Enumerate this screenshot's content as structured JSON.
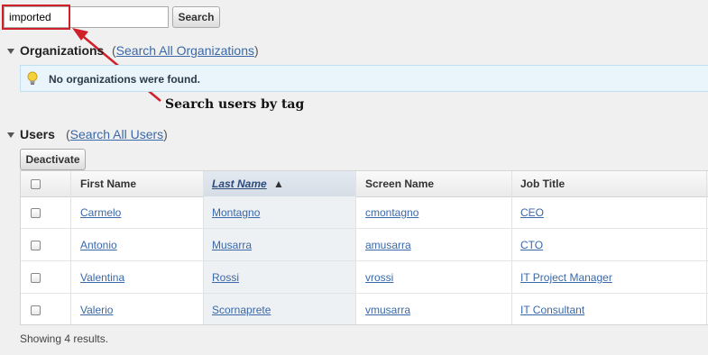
{
  "search": {
    "value": "imported",
    "button_label": "Search"
  },
  "annotation": {
    "text": "Search users by tag"
  },
  "organizations": {
    "title": "Organizations",
    "link_open": "(",
    "link_label": "Search All Organizations",
    "link_close": ")",
    "message": "No organizations were found."
  },
  "users": {
    "title": "Users",
    "link_open": "(",
    "link_label": "Search All Users",
    "link_close": ")",
    "deactivate_label": "Deactivate",
    "columns": [
      "First Name",
      "Last Name",
      "Screen Name",
      "Job Title"
    ],
    "sort_indicator": "▲",
    "rows": [
      {
        "first": "Carmelo",
        "last": "Montagno",
        "screen": "cmontagno",
        "job": "CEO"
      },
      {
        "first": "Antonio",
        "last": "Musarra",
        "screen": "amusarra",
        "job": "CTO"
      },
      {
        "first": "Valentina",
        "last": "Rossi",
        "screen": "vrossi",
        "job": "IT Project Manager"
      },
      {
        "first": "Valerio",
        "last": "Scornaprete",
        "screen": "vmusarra",
        "job": "IT Consultant"
      }
    ],
    "footer": "Showing 4 results."
  },
  "colors": {
    "link": "#3a68a8",
    "highlight": "#d0202a",
    "info_bg": "#eaf4fb"
  },
  "icons": {
    "info": "lightbulb-icon",
    "sort": "sort-ascending-icon"
  }
}
